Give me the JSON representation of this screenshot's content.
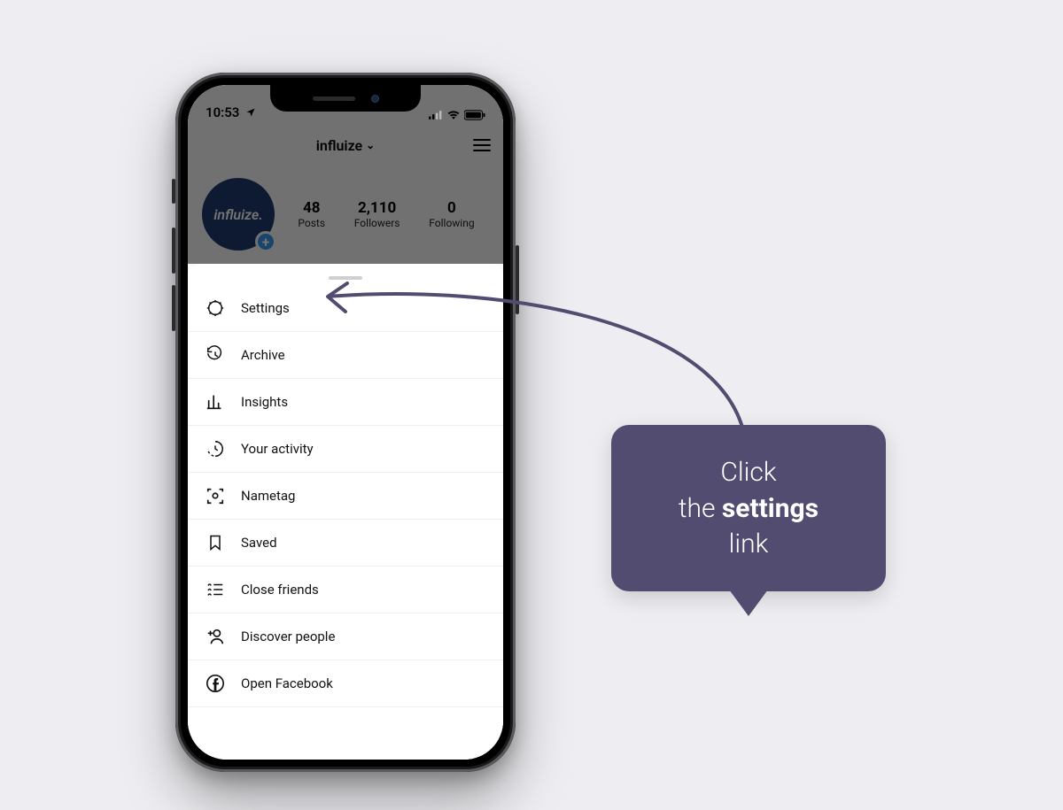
{
  "statusbar": {
    "time": "10:53"
  },
  "header": {
    "username": "influize"
  },
  "profile": {
    "avatar_text": "influize.",
    "stats": {
      "posts": {
        "value": "48",
        "label": "Posts"
      },
      "followers": {
        "value": "2,110",
        "label": "Followers"
      },
      "following": {
        "value": "0",
        "label": "Following"
      }
    }
  },
  "menu": [
    {
      "key": "settings",
      "label": "Settings"
    },
    {
      "key": "archive",
      "label": "Archive"
    },
    {
      "key": "insights",
      "label": "Insights"
    },
    {
      "key": "your-activity",
      "label": "Your activity"
    },
    {
      "key": "nametag",
      "label": "Nametag"
    },
    {
      "key": "saved",
      "label": "Saved"
    },
    {
      "key": "close-friends",
      "label": "Close friends"
    },
    {
      "key": "discover-people",
      "label": "Discover people"
    },
    {
      "key": "open-facebook",
      "label": "Open Facebook"
    }
  ],
  "callout": {
    "line1": "Click",
    "line2_prefix": "the ",
    "line2_bold": "settings",
    "line3": "link"
  },
  "colors": {
    "accent": "#534c71",
    "avatar_bg": "#1e3a6f"
  }
}
